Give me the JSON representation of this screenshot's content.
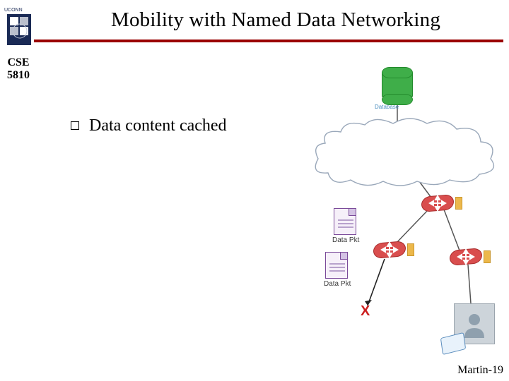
{
  "title": "Mobility with Named Data Networking",
  "course": {
    "dept": "CSE",
    "num": "5810"
  },
  "bullet_text": "Data content cached",
  "footer": "Martin-19",
  "diagram": {
    "database_label": "Database",
    "data_pkt_label": "Data Pkt",
    "red_x": "X"
  },
  "brand": {
    "accent_red": "#9a0000",
    "router_red": "#d94e4e",
    "db_green": "#3fae49",
    "pkt_purple": "#7a4a99"
  }
}
